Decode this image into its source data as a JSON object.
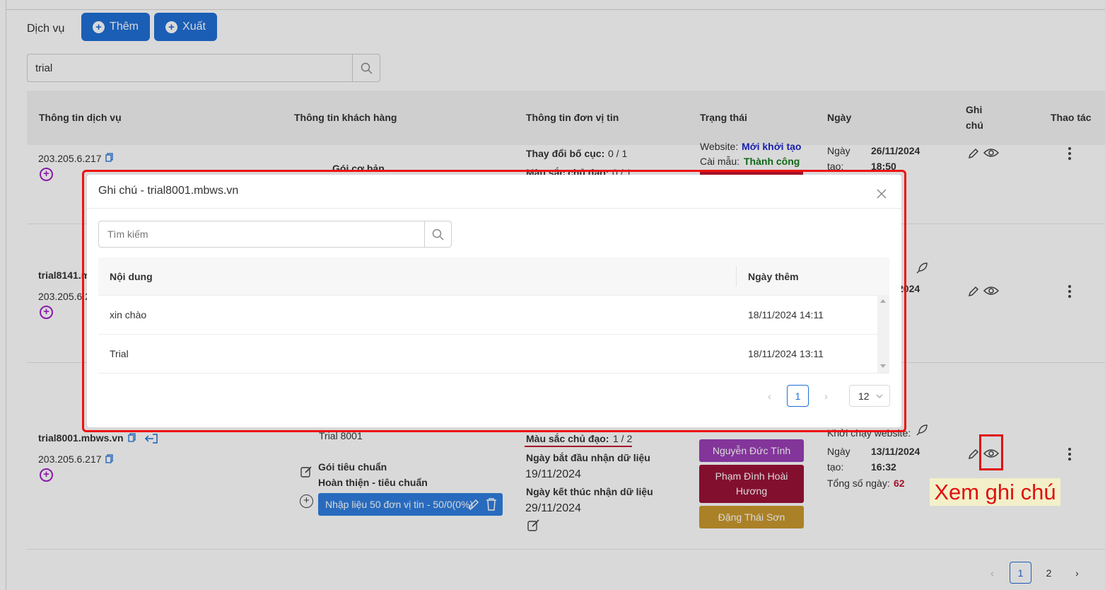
{
  "page": {
    "title": "Dịch vụ",
    "add_button": "Thêm",
    "export_button": "Xuất",
    "search_value": "trial"
  },
  "table": {
    "headers": {
      "service_info": "Thông tin dịch vụ",
      "customer_info": "Thông tin khách hàng",
      "unit_info": "Thông tin đơn vị tin",
      "status": "Trạng thái",
      "date": "Ngày",
      "note_line1": "Ghi",
      "note_line2": "chú",
      "actions": "Thao tác"
    },
    "row1": {
      "ip": "203.205.6.217",
      "package": "Gói cơ bản",
      "layout_change": "Thay đổi bố cục:",
      "layout_value": "0 / 1",
      "color_label": "Màu sắc chủ đạo:",
      "color_value": "0 / 1",
      "website_label": "Website:",
      "website_value": "Mới khởi tạo",
      "template_label": "Cài mẫu:",
      "template_value": "Thành công",
      "date_label1": "Ngày",
      "date_label2": "tạo:",
      "date_value": "26/11/2024",
      "time_value": "18:50"
    },
    "row2": {
      "domain": "trial8141.m",
      "ip": "203.205.6.2",
      "date_value": "2024"
    },
    "row3": {
      "domain": "trial8001.mbws.vn",
      "ip": "203.205.6.217",
      "customer_name": "Trial 8001",
      "package": "Gói tiêu chuẩn",
      "package_detail": "Hoàn thiện - tiêu chuẩn",
      "data_entry": "Nhập liệu 50 đơn vị tin - 50/0(0%)",
      "color_label": "Màu sắc chủ đạo:",
      "color_value": "1 / 2",
      "start_label": "Ngày bắt đầu nhận dữ liệu",
      "start_value": "19/11/2024",
      "end_label": "Ngày kết thúc nhận dữ liệu",
      "end_value": "29/11/2024",
      "staff": [
        "Nguyễn Đức Tính",
        "Phạm Đình Hoài Hương",
        "Đặng Thái Sơn"
      ],
      "launch_label": "Khởi chạy website:",
      "date_label1": "Ngày",
      "date_label2": "tạo:",
      "date_value": "13/11/2024",
      "time_value": "16:32",
      "total_days_label": "Tổng số ngày:",
      "total_days_value": "62"
    },
    "pagination": {
      "current": "1",
      "next_page": "2"
    }
  },
  "modal": {
    "title": "Ghi chú - trial8001.mbws.vn",
    "search_placeholder": "Tìm kiếm",
    "col_content": "Nội dung",
    "col_date": "Ngày thêm",
    "rows": [
      {
        "content": "xin chào",
        "date": "18/11/2024 14:11"
      },
      {
        "content": "Trial",
        "date": "18/11/2024 13:11"
      }
    ],
    "current_page": "1",
    "page_size": "12"
  },
  "annotation": {
    "label": "Xem ghi chú"
  },
  "colors": {
    "primary": "#1f6fd6",
    "highlight_red": "#e01010",
    "tag_purple": "#9b3fb5",
    "tag_maroon": "#9b1237",
    "tag_gold": "#c9982e",
    "status_blue": "#1d27c9",
    "status_green": "#127a1a"
  }
}
